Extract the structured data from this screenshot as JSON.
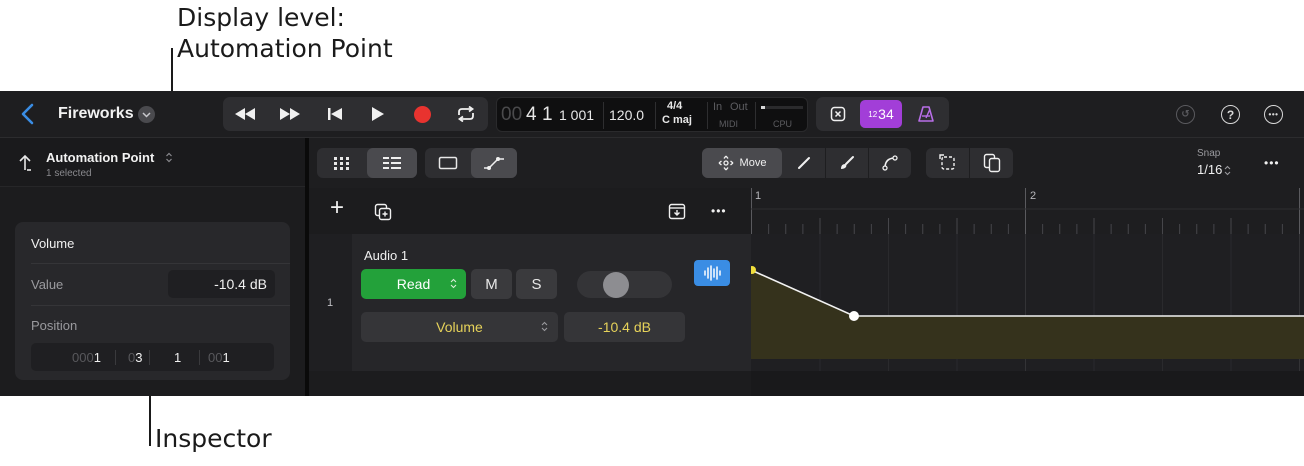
{
  "callouts": {
    "display_level": "Display level:\nAutomation Point",
    "inspector": "Inspector"
  },
  "topbar": {
    "project_title": "Fireworks",
    "lcd": {
      "position_bars": "4",
      "position_beats": "1",
      "position_ticks": "1 001",
      "position_prefix": "00",
      "tempo": "120.0",
      "signature": "4/4",
      "key": "C maj",
      "in_label": "In",
      "out_label": "Out",
      "midi_label": "MIDI",
      "cpu_label": "CPU"
    },
    "count_in_main": "34",
    "count_in_small": "12"
  },
  "inspector": {
    "title": "Automation Point",
    "subtitle": "1 selected",
    "section_title": "Volume",
    "value_label": "Value",
    "value": "-10.4 dB",
    "position_label": "Position",
    "position": {
      "bar_zeros": "000",
      "bar": "1",
      "beat_zeros": "0",
      "beat": "3",
      "division": "1",
      "tick_zeros": "00",
      "tick": "1"
    }
  },
  "toolbar": {
    "move_label": "Move",
    "snap_label": "Snap",
    "snap_value": "1/16"
  },
  "track": {
    "number": "1",
    "name": "Audio 1",
    "automation_mode": "Read",
    "mute_label": "M",
    "solo_label": "S",
    "parameter": "Volume",
    "parameter_value": "-10.4 dB",
    "pan": 0.38
  },
  "ruler": {
    "bar1": "1",
    "bar2": "2"
  },
  "automation": {
    "start_level": 0.74,
    "end_level": 0.4,
    "point_position_beats": 3
  },
  "colors": {
    "accent_blue": "#3a8de4",
    "read_green": "#23a13a",
    "record_red": "#e8332f",
    "count_in_purple": "#a23ed8",
    "automation_yellow": "#e6d25a"
  }
}
